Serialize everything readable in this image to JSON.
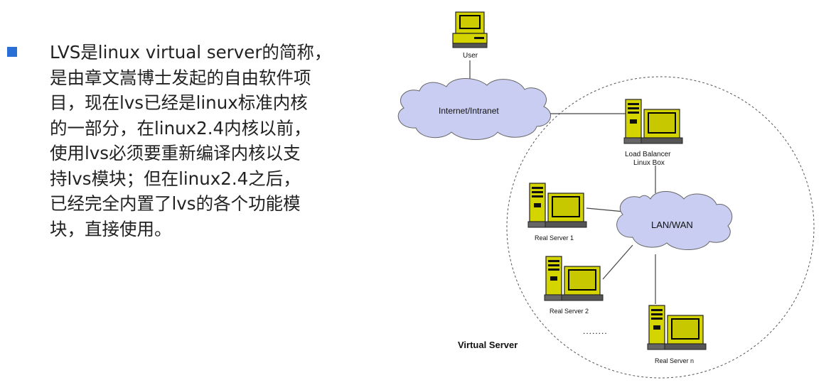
{
  "slide": {
    "bullet_lines": [
      "LVS是linux virtual server的简称，",
      "是由章文嵩博士发起的自由软件项",
      "目，现在lvs已经是linux标准内核",
      "的一部分，在linux2.4内核以前，",
      "使用lvs必须要重新编译内核以支",
      "持lvs模块；但在linux2.4之后，",
      "已经完全内置了lvs的各个功能模",
      "块，直接使用。"
    ],
    "accent_color": "#2a6fd6"
  },
  "diagram": {
    "user_label": "User",
    "internet_label": "Internet/Intranet",
    "lb_label_1": "Load Balancer",
    "lb_label_2": "Linux Box",
    "lan_label": "LAN/WAN",
    "rs1_label": "Real Server 1",
    "rs2_label": "Real Server 2",
    "rsn_label": "Real Server n",
    "ellipsis": "........",
    "virtual_server_label": "Virtual Server",
    "cloud_color": "#c9cdf2",
    "computer_color": "#d4d400"
  }
}
